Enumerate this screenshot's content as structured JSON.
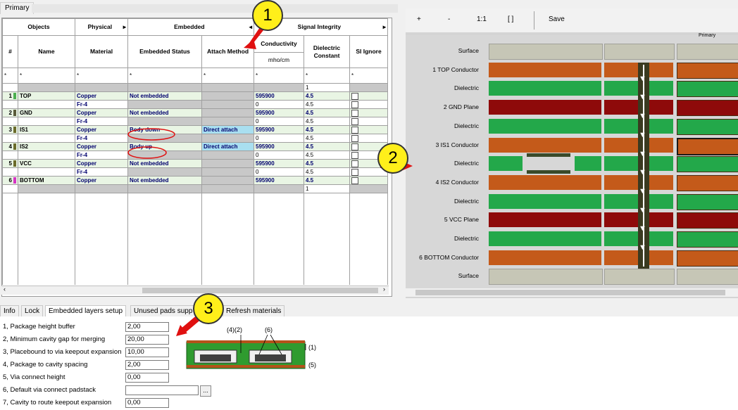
{
  "window": {
    "top_tab": "Primary"
  },
  "grid": {
    "group_headers": [
      "Objects",
      "Physical",
      "Embedded",
      "Signal Integrity"
    ],
    "columns": [
      "#",
      "Name",
      "Material",
      "Embedded Status",
      "Attach Method",
      "Conductivity",
      "Dielectric Constant",
      "SI Ignore"
    ],
    "conductivity_unit": "mho/cm",
    "filter_char": "*",
    "rows": [
      {
        "num": "",
        "name": "",
        "material": "",
        "status": "",
        "attach": "",
        "cond": "",
        "dk": "1",
        "si": false,
        "type": "surface",
        "color": ""
      },
      {
        "num": "1",
        "name": "TOP",
        "material": "Copper",
        "status": "Not embedded",
        "attach": "",
        "cond": "595900",
        "dk": "4.5",
        "si": true,
        "type": "cond",
        "color": "#4caf50"
      },
      {
        "num": "",
        "name": "",
        "material": "Fr-4",
        "status": "",
        "attach": "",
        "cond": "0",
        "dk": "4.5",
        "si": true,
        "type": "diel",
        "color": ""
      },
      {
        "num": "2",
        "name": "GND",
        "material": "Copper",
        "status": "Not embedded",
        "attach": "",
        "cond": "595900",
        "dk": "4.5",
        "si": true,
        "type": "cond",
        "color": "#5a5a3a"
      },
      {
        "num": "",
        "name": "",
        "material": "Fr-4",
        "status": "",
        "attach": "",
        "cond": "0",
        "dk": "4.5",
        "si": true,
        "type": "diel",
        "color": ""
      },
      {
        "num": "3",
        "name": "IS1",
        "material": "Copper",
        "status": "Body down",
        "attach": "Direct attach",
        "cond": "595900",
        "dk": "4.5",
        "si": true,
        "type": "cond",
        "color": "#6b6b2a"
      },
      {
        "num": "",
        "name": "",
        "material": "Fr-4",
        "status": "",
        "attach": "",
        "cond": "0",
        "dk": "4.5",
        "si": true,
        "type": "diel",
        "color": ""
      },
      {
        "num": "4",
        "name": "IS2",
        "material": "Copper",
        "status": "Body up",
        "attach": "Direct attach",
        "cond": "595900",
        "dk": "4.5",
        "si": true,
        "type": "cond",
        "color": "#6b6b2a"
      },
      {
        "num": "",
        "name": "",
        "material": "Fr-4",
        "status": "",
        "attach": "",
        "cond": "0",
        "dk": "4.5",
        "si": true,
        "type": "diel",
        "color": ""
      },
      {
        "num": "5",
        "name": "VCC",
        "material": "Copper",
        "status": "Not embedded",
        "attach": "",
        "cond": "595900",
        "dk": "4.5",
        "si": true,
        "type": "cond",
        "color": "#6b6b2a"
      },
      {
        "num": "",
        "name": "",
        "material": "Fr-4",
        "status": "",
        "attach": "",
        "cond": "0",
        "dk": "4.5",
        "si": true,
        "type": "diel",
        "color": ""
      },
      {
        "num": "6",
        "name": "BOTTOM",
        "material": "Copper",
        "status": "Not embedded",
        "attach": "",
        "cond": "595900",
        "dk": "4.5",
        "si": true,
        "type": "cond",
        "color": "#d633c4"
      },
      {
        "num": "",
        "name": "",
        "material": "",
        "status": "",
        "attach": "",
        "cond": "",
        "dk": "1",
        "si": false,
        "type": "surface",
        "color": ""
      }
    ]
  },
  "viewer": {
    "toolbar": [
      "+",
      "-",
      "1:1",
      "[ ]",
      "Save"
    ],
    "column_header": "Primary",
    "layers": [
      {
        "label": "Surface",
        "kind": "surface"
      },
      {
        "label": "1    TOP Conductor",
        "kind": "conductor"
      },
      {
        "label": "Dielectric",
        "kind": "dielectric"
      },
      {
        "label": "2    GND Plane",
        "kind": "plane"
      },
      {
        "label": "Dielectric",
        "kind": "dielectric"
      },
      {
        "label": "3    IS1 Conductor",
        "kind": "conductor"
      },
      {
        "label": "Dielectric",
        "kind": "dielectric"
      },
      {
        "label": "4    IS2 Conductor",
        "kind": "conductor"
      },
      {
        "label": "Dielectric",
        "kind": "dielectric"
      },
      {
        "label": "5    VCC Plane",
        "kind": "plane"
      },
      {
        "label": "Dielectric",
        "kind": "dielectric"
      },
      {
        "label": "6    BOTTOM Conductor",
        "kind": "conductor"
      },
      {
        "label": "Surface",
        "kind": "surface"
      }
    ],
    "colors": {
      "surface": "#c6c6b6",
      "conductor": "#c45a1a",
      "dielectric": "#23a84a",
      "plane": "#8e0a0a",
      "via": "#3a3a20"
    }
  },
  "bottom_tabs": [
    "Info",
    "Lock",
    "Embedded layers setup",
    "Unused pads supp",
    "Refresh materials"
  ],
  "form": [
    {
      "label": "1, Package height buffer",
      "value": "2,00"
    },
    {
      "label": "2, Minimum cavity gap for merging",
      "value": "20,00"
    },
    {
      "label": "3, Placebound to via keepout expansion",
      "value": "10,00"
    },
    {
      "label": "4, Package to cavity spacing",
      "value": "2,00"
    },
    {
      "label": "5, Via connect height",
      "value": "0,00"
    },
    {
      "label": "6, Default via connect padstack",
      "value": ""
    },
    {
      "label": "7, Cavity to route keepout expansion",
      "value": "0,00"
    }
  ],
  "browse_label": "...",
  "diagram_labels": {
    "top": "(4)(2)",
    "six": "(6)",
    "one": "(1)",
    "five": "(5)"
  },
  "callouts": [
    "1",
    "2",
    "3"
  ]
}
